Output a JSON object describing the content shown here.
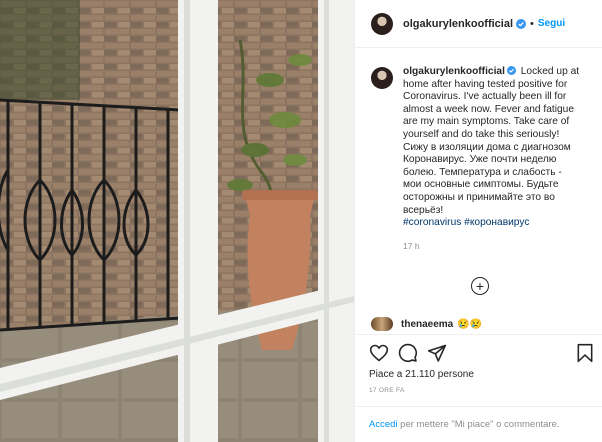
{
  "post": {
    "username": "olgakurylenkoofficial",
    "follow_label": "Segui",
    "separator": "•",
    "caption_lines": [
      "Locked up at",
      "home after having tested positive for",
      "Coronavirus. I've actually been ill for",
      "almost a week now. Fever and fatigue",
      "are my main symptoms. Take care of",
      "yourself and do take this seriously!",
      "Сижу в изоляции дома с диагнозом",
      "Коронавирус. Уже почти неделю",
      "болею. Температура и слабость -",
      "мои основные симптомы. Будьте",
      "осторожны и принимайте это во",
      "всерьёз!"
    ],
    "hashtags": [
      "#coronavirus",
      "#коронавирус"
    ],
    "time": "17 h",
    "more_comments_glyph": "+"
  },
  "comment": {
    "username": "thenaeema",
    "text": "😢😢"
  },
  "engagement": {
    "likes_text": "Piace a 21.110 persone",
    "ago": "17 ORE FA"
  },
  "login_prompt": {
    "link": "Accedi",
    "text": " per mettere \"Mi piace\" o commentare."
  },
  "colors": {
    "link_blue": "#0095f6",
    "hashtag_blue": "#00376b",
    "muted_gray": "#8e8e8e",
    "text": "#262626",
    "border": "#efefef"
  },
  "icons": {
    "like": "heart-icon",
    "comment": "speech-bubble-icon",
    "share": "paper-plane-icon",
    "save": "bookmark-icon",
    "verified": "verified-badge-icon",
    "more": "plus-circle-icon"
  }
}
